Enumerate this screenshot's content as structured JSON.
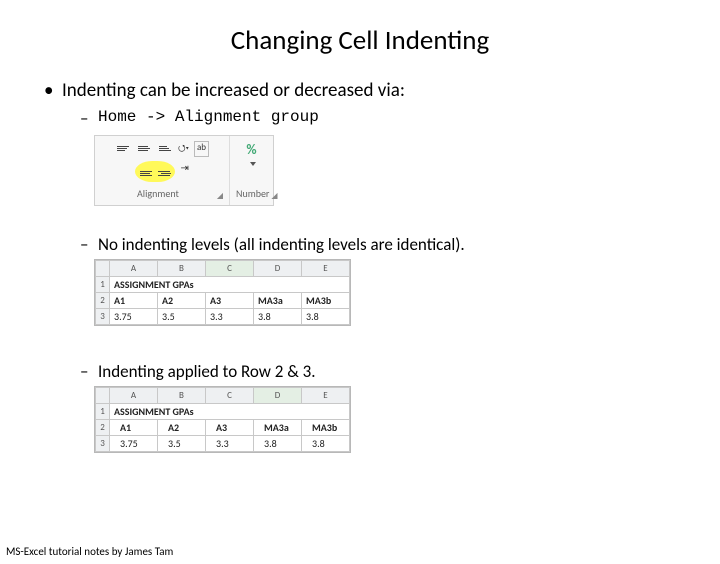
{
  "title": "Changing Cell Indenting",
  "b1": "Indenting can be increased or decreased via:",
  "b2a": "Home -> Alignment group",
  "b2b": "No indenting levels (all indenting levels are identical).",
  "b2c": "Indenting applied to Row 2 & 3.",
  "footer": "MS-Excel tutorial notes by James Tam",
  "ribbon": {
    "wrap": "ab",
    "percent": "%",
    "align_label": "Alignment",
    "num_label": "Number"
  },
  "sheet": {
    "cols": [
      "A",
      "B",
      "C",
      "D",
      "E"
    ],
    "rows": [
      "1",
      "2",
      "3"
    ],
    "r1": "ASSIGNMENT GPAs",
    "h": [
      "A1",
      "A2",
      "A3",
      "MA3a",
      "MA3b"
    ],
    "d": [
      "3.75",
      "3.5",
      "3.3",
      "3.8",
      "3.8"
    ]
  }
}
